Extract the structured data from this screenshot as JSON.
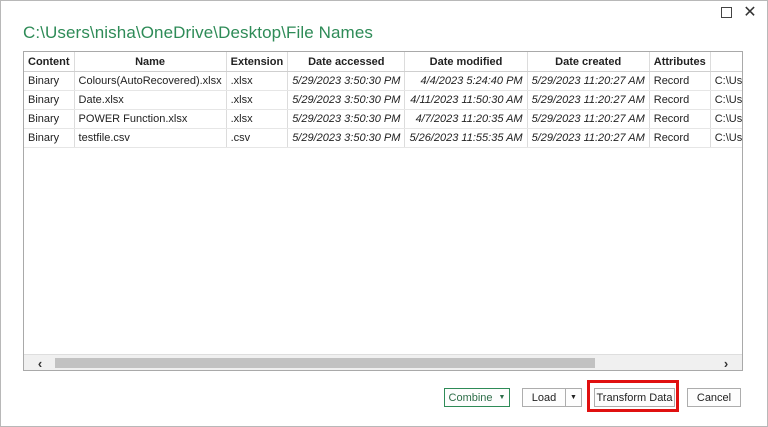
{
  "window": {
    "title": "C:\\Users\\nisha\\OneDrive\\Desktop\\File Names",
    "maximize_icon": "maximize-icon",
    "close_glyph": "✕"
  },
  "table": {
    "columns": [
      "Content",
      "Name",
      "Extension",
      "Date accessed",
      "Date modified",
      "Date created",
      "Attributes",
      ""
    ],
    "rows": [
      [
        "Binary",
        "Colours(AutoRecovered).xlsx",
        ".xlsx",
        "5/29/2023 3:50:30 PM",
        "4/4/2023 5:24:40 PM",
        "5/29/2023 11:20:27 AM",
        "Record",
        "C:\\Users\\nish"
      ],
      [
        "Binary",
        "Date.xlsx",
        ".xlsx",
        "5/29/2023 3:50:30 PM",
        "4/11/2023 11:50:30 AM",
        "5/29/2023 11:20:27 AM",
        "Record",
        "C:\\Users\\nish"
      ],
      [
        "Binary",
        "POWER Function.xlsx",
        ".xlsx",
        "5/29/2023 3:50:30 PM",
        "4/7/2023 11:20:35 AM",
        "5/29/2023 11:20:27 AM",
        "Record",
        "C:\\Users\\nish"
      ],
      [
        "Binary",
        "testfile.csv",
        ".csv",
        "5/29/2023 3:50:30 PM",
        "5/26/2023 11:55:35 AM",
        "5/29/2023 11:20:27 AM",
        "Record",
        "C:\\Users\\nish"
      ]
    ]
  },
  "scrollbar": {
    "left_glyph": "‹",
    "right_glyph": "›"
  },
  "buttons": {
    "combine": "Combine",
    "combine_caret": "▼",
    "load": "Load",
    "load_caret": "▼",
    "transform": "Transform Data",
    "cancel": "Cancel"
  },
  "colors": {
    "title": "#2e8b57",
    "highlight": "#e01010"
  }
}
